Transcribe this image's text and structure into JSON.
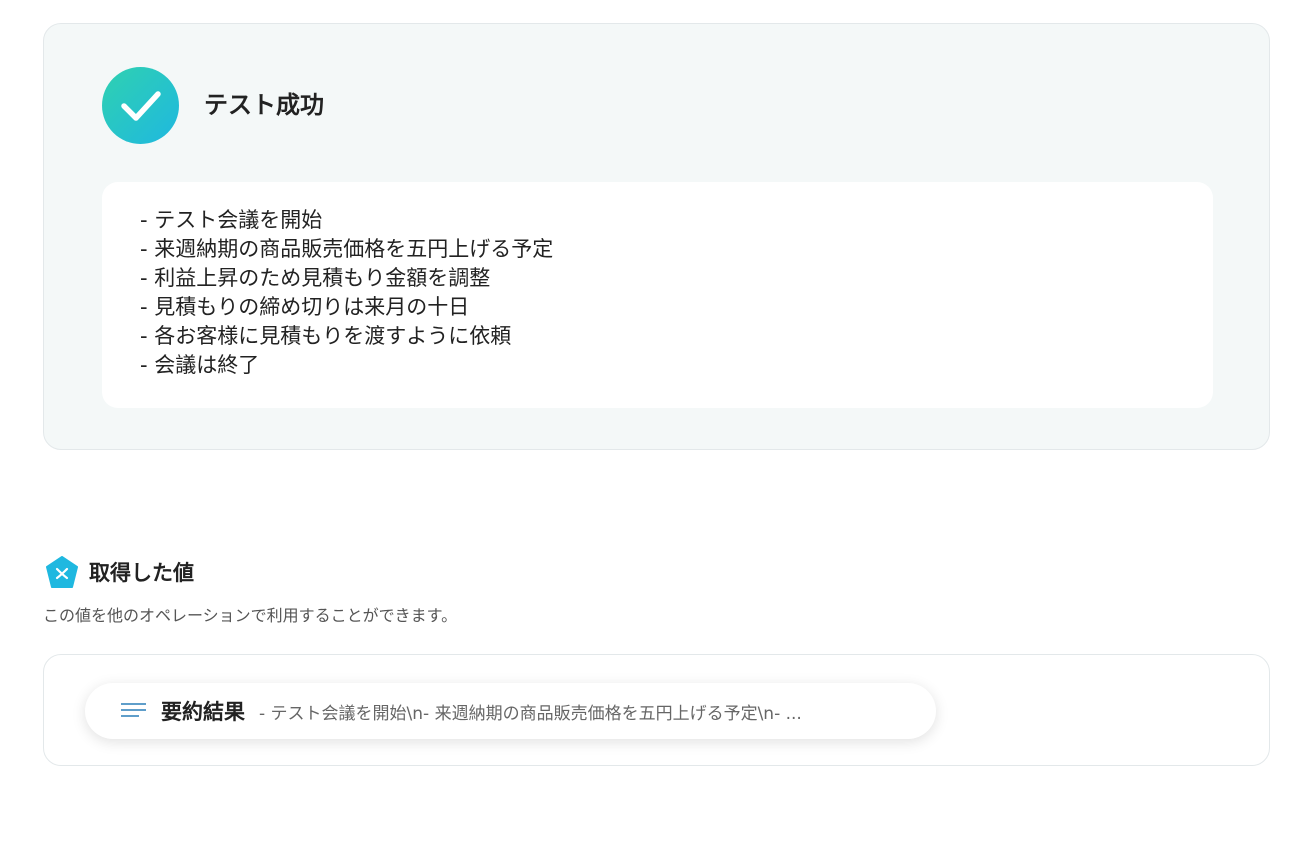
{
  "success": {
    "title": "テスト成功",
    "result_lines": [
      "- テスト会議を開始",
      "- 来週納期の商品販売価格を五円上げる予定",
      "- 利益上昇のため見積もり金額を調整",
      "- 見積もりの締め切りは来月の十日",
      "- 各お客様に見積もりを渡すように依頼",
      "- 会議は終了"
    ]
  },
  "values": {
    "title": "取得した値",
    "description": "この値を他のオペレーションで利用することができます。",
    "items": [
      {
        "key": "要約結果",
        "preview": "- テスト会議を開始\\n- 来週納期の商品販売価格を五円上げる予定\\n- ..."
      }
    ]
  },
  "colors": {
    "success_gradient_start": "#2fd1b0",
    "success_gradient_end": "#1fb8e0",
    "accent_icon": "#1fb8e0"
  },
  "icons": {
    "success": "check-icon",
    "values": "yoom-pentagon-icon",
    "item": "text-lines-icon"
  }
}
